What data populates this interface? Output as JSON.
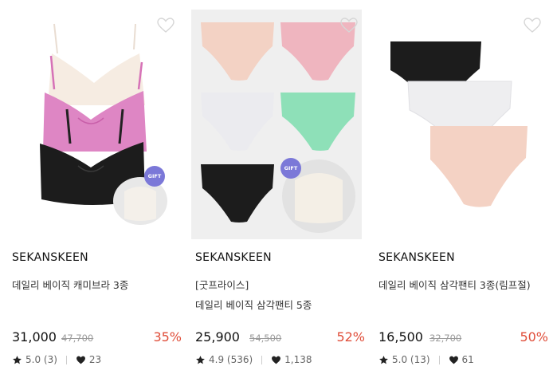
{
  "products": [
    {
      "brand": "SEKANSKEEN",
      "title_lines": [
        "데일리 베이직 캐미브라 3종"
      ],
      "price": "31,000",
      "original_price": "47,700",
      "discount": "35%",
      "rating": "5.0 (3)",
      "likes": "23",
      "gift_badge": "GIFT",
      "image_icon": "camisole-bra-set-image"
    },
    {
      "brand": "SEKANSKEEN",
      "title_lines": [
        "[굿프라이스]",
        "데일리 베이직 삼각팬티 5종"
      ],
      "price": "25,900",
      "original_price": "54,500",
      "discount": "52%",
      "rating": "4.9 (536)",
      "likes": "1,138",
      "gift_badge": "GIFT",
      "image_icon": "brief-panties-set-image"
    },
    {
      "brand": "SEKANSKEEN",
      "title_lines": [
        "데일리 베이직 삼각팬티 3종(림프절)"
      ],
      "price": "16,500",
      "original_price": "32,700",
      "discount": "50%",
      "rating": "5.0 (13)",
      "likes": "61",
      "image_icon": "brief-panties-stack-image"
    }
  ],
  "colors": {
    "discount": "#e04e3a",
    "gift_badge": "#7b78d8",
    "image_bg": "#efefef"
  }
}
